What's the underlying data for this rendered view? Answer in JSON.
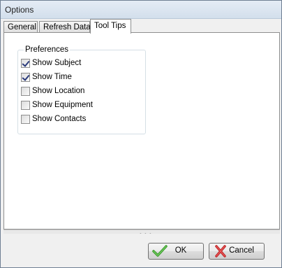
{
  "window": {
    "title": "Options"
  },
  "tabs": [
    {
      "label": "General"
    },
    {
      "label": "Refresh Data"
    },
    {
      "label": "Tool Tips"
    }
  ],
  "preferences": {
    "group_label": "Preferences",
    "items": [
      {
        "label": "Show Subject",
        "checked": true
      },
      {
        "label": "Show Time",
        "checked": true
      },
      {
        "label": "Show Location",
        "checked": false
      },
      {
        "label": "Show Equipment",
        "checked": false
      },
      {
        "label": "Show Contacts",
        "checked": false
      }
    ]
  },
  "splitter": {
    "grip": "• • •"
  },
  "buttons": {
    "ok_label": "OK",
    "cancel_label": "Cancel"
  },
  "icons": {
    "ok": "check-icon",
    "cancel": "x-icon"
  },
  "colors": {
    "check_green": "#3a9a2a",
    "cancel_red": "#c0282a"
  }
}
